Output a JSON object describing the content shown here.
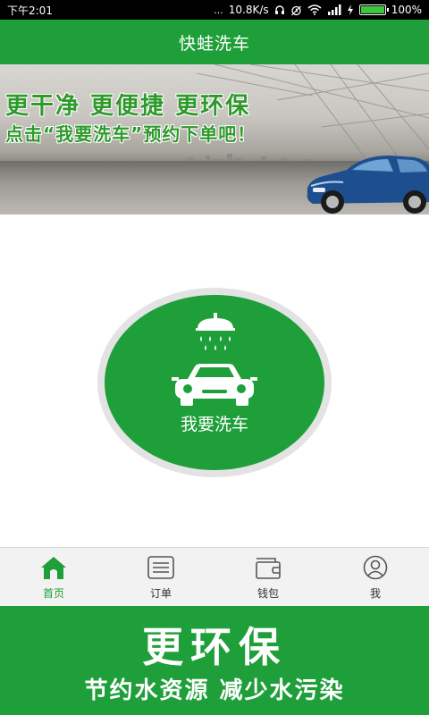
{
  "status_bar": {
    "time": "下午2:01",
    "dots": "...",
    "network_speed": "10.8K/s",
    "headphone_icon": "headphone-icon",
    "alarm_icon": "alarm-icon",
    "wifi_icon": "wifi-icon",
    "signal_icon": "signal-icon",
    "charging_icon": "charging-icon",
    "battery_percent": "100%",
    "battery_level": 1.0
  },
  "header": {
    "title": "快蛙洗车"
  },
  "banner": {
    "line1": "更干净 更便捷 更环保",
    "line2": "点击“我要洗车”预约下单吧！"
  },
  "main": {
    "wash_button_label": "我要洗车",
    "shower_icon": "shower-icon",
    "car_icon": "car-icon"
  },
  "bottom_nav": {
    "items": [
      {
        "label": "首页",
        "icon": "home-icon",
        "active": true
      },
      {
        "label": "订单",
        "icon": "order-list-icon",
        "active": false
      },
      {
        "label": "钱包",
        "icon": "wallet-icon",
        "active": false
      },
      {
        "label": "我",
        "icon": "user-icon",
        "active": false
      }
    ]
  },
  "footer": {
    "line1": "更环保",
    "line2": "节约水资源 减少水污染"
  },
  "colors": {
    "brand_green": "#1e9f3a",
    "status_bar": "#000000",
    "nav_background": "#f2f2f2",
    "banner_text_green": "#2e9a2a"
  }
}
